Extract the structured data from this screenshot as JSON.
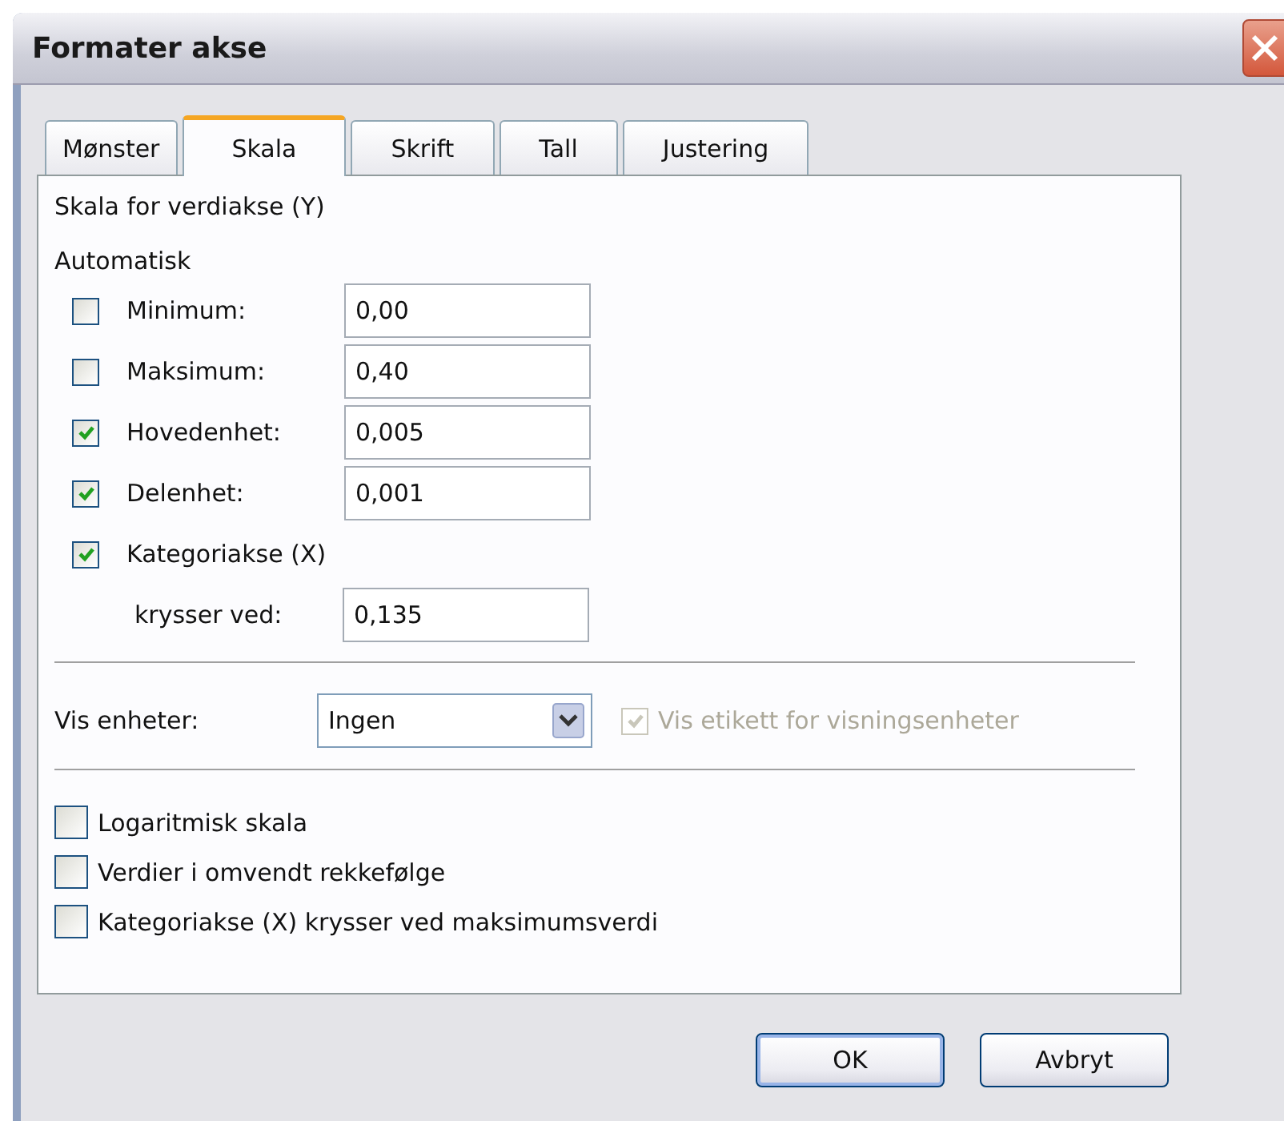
{
  "window": {
    "title": "Formater akse"
  },
  "tabs": [
    {
      "label": "Mønster",
      "selected": false
    },
    {
      "label": "Skala",
      "selected": true
    },
    {
      "label": "Skrift",
      "selected": false
    },
    {
      "label": "Tall",
      "selected": false
    },
    {
      "label": "Justering",
      "selected": false
    }
  ],
  "heading": "Skala for verdiakse (Y)",
  "auto_group": {
    "label": "Automatisk",
    "rows": [
      {
        "kind": "check_field",
        "label": "Minimum:",
        "checked": false,
        "value": "0,00"
      },
      {
        "kind": "check_field",
        "label": "Maksimum:",
        "checked": false,
        "value": "0,40"
      },
      {
        "kind": "check_field",
        "label": "Hovedenhet:",
        "checked": true,
        "value": "0,005"
      },
      {
        "kind": "check_field",
        "label": "Delenhet:",
        "checked": true,
        "value": "0,001"
      },
      {
        "kind": "check",
        "label": "Kategoriakse (X)",
        "checked": true
      },
      {
        "kind": "field",
        "label": "krysser ved:",
        "value": "0,135"
      }
    ]
  },
  "display_units": {
    "label": "Vis enheter:",
    "value": "Ingen",
    "show_label": {
      "label": "Vis etikett for visningsenheter",
      "checked": true,
      "disabled": true
    }
  },
  "options": [
    {
      "label": "Logaritmisk skala",
      "checked": false
    },
    {
      "label": "Verdier i omvendt rekkefølge",
      "checked": false
    },
    {
      "label": "Kategoriakse (X) krysser ved maksimumsverdi",
      "checked": false
    }
  ],
  "buttons": [
    {
      "label": "OK",
      "default": true
    },
    {
      "label": "Avbryt",
      "default": false
    }
  ]
}
